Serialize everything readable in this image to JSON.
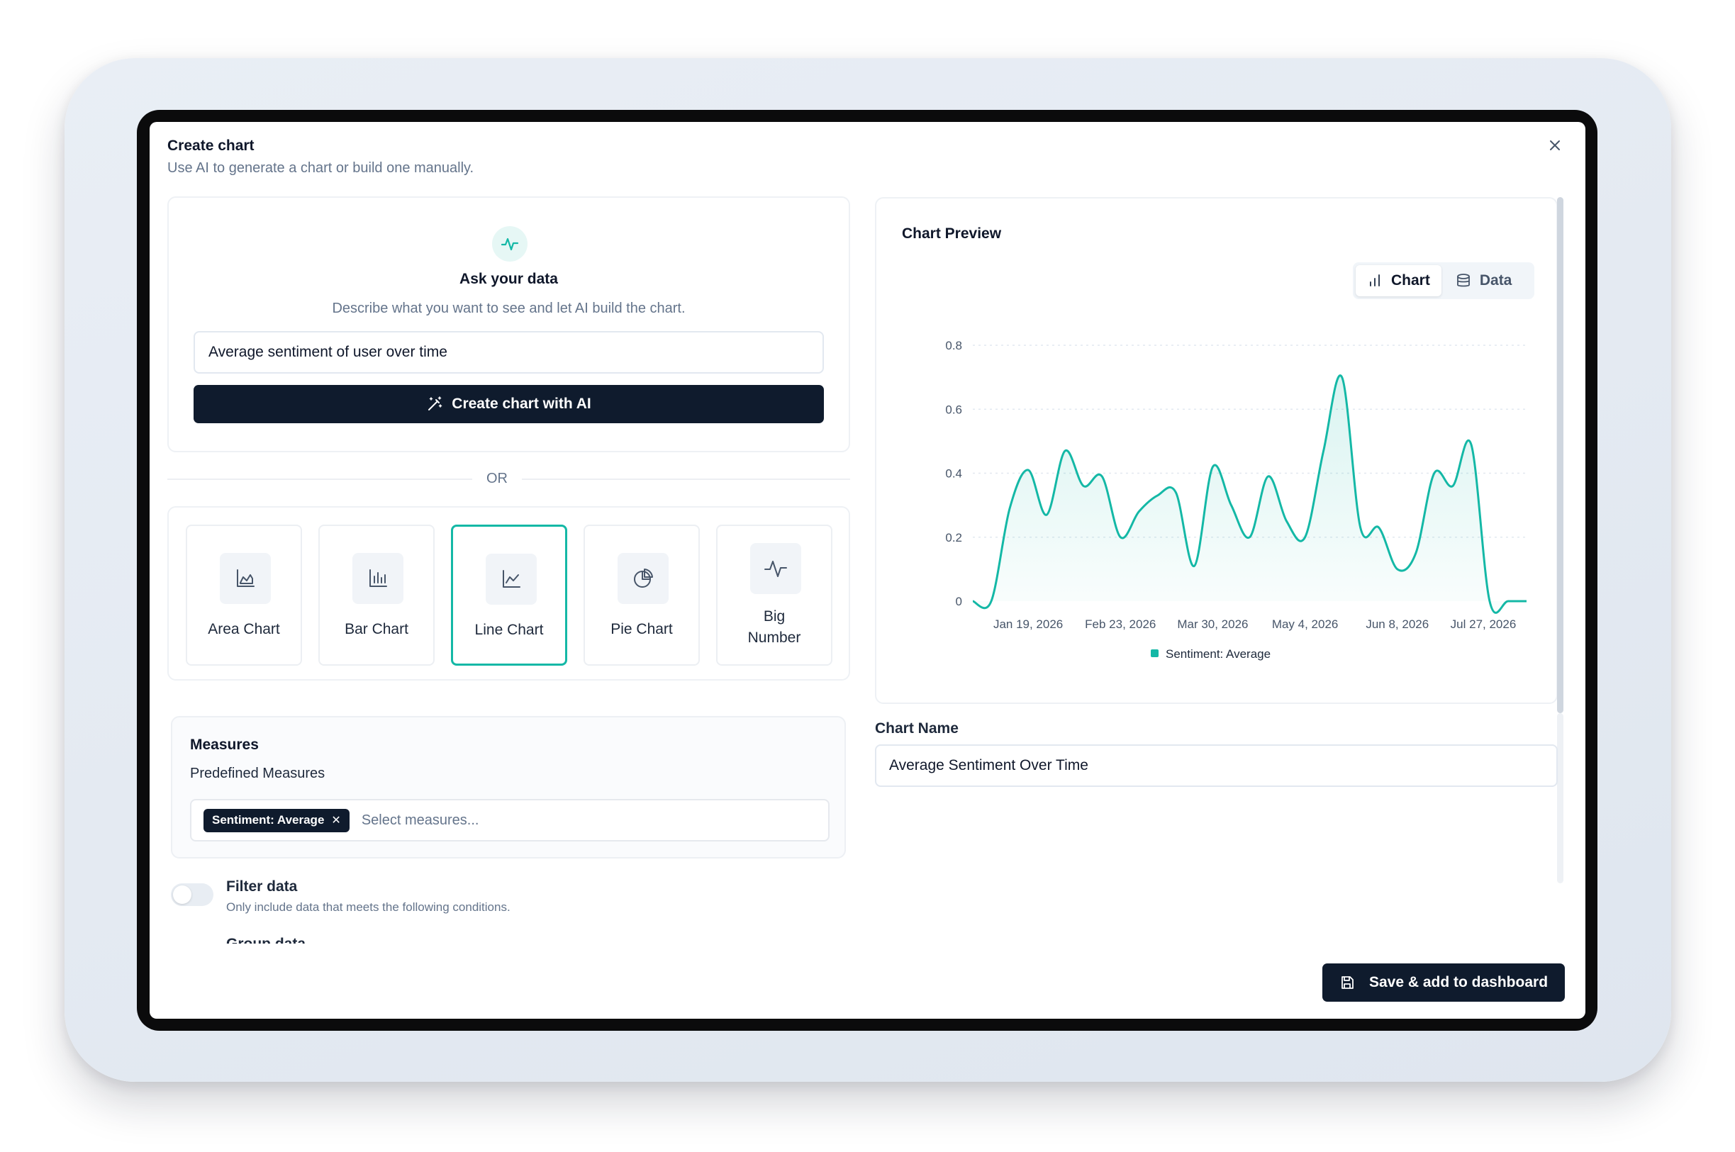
{
  "dialog": {
    "title": "Create chart",
    "subtitle": "Use AI to generate a chart or build one manually."
  },
  "ai": {
    "heading": "Ask your data",
    "description": "Describe what you want to see and let AI build the chart.",
    "prompt_value": "Average sentiment of user over time",
    "button_label": "Create chart with AI",
    "icon": "pulse-icon"
  },
  "divider": {
    "or_label": "OR"
  },
  "chart_types": [
    {
      "label": "Area Chart",
      "icon": "area-chart-icon",
      "selected": false
    },
    {
      "label": "Bar Chart",
      "icon": "bar-chart-icon",
      "selected": false
    },
    {
      "label": "Line Chart",
      "icon": "line-chart-icon",
      "selected": true
    },
    {
      "label": "Pie Chart",
      "icon": "pie-chart-icon",
      "selected": false
    },
    {
      "label": "Big Number",
      "icon": "pulse-icon",
      "selected": false
    }
  ],
  "measures": {
    "title": "Measures",
    "subtitle": "Predefined Measures",
    "chip_label": "Sentiment: Average",
    "placeholder": "Select measures..."
  },
  "filter": {
    "title": "Filter data",
    "description": "Only include data that meets the following conditions.",
    "enabled": false
  },
  "group": {
    "title": "Group data"
  },
  "preview": {
    "title": "Chart Preview",
    "tab_chart": "Chart",
    "tab_data": "Data",
    "active_tab": "Chart"
  },
  "chart_name": {
    "label": "Chart Name",
    "value": "Average Sentiment Over Time"
  },
  "save_button": {
    "label": "Save & add to dashboard"
  },
  "colors": {
    "accent": "#14b8a6",
    "primary_button": "#0f1b2d"
  },
  "chart_data": {
    "type": "area",
    "x_tick_labels": [
      "Jan 19, 2026",
      "Feb 23, 2026",
      "Mar 30, 2026",
      "May 4, 2026",
      "Jun 8, 2026",
      "Jul 27, 2026"
    ],
    "y_tick_labels": [
      "0",
      "0.2",
      "0.4",
      "0.6",
      "0.8"
    ],
    "ylim": [
      0,
      0.8
    ],
    "grid": "horizontal-dashed",
    "legend_position": "bottom",
    "series": [
      {
        "name": "Sentiment: Average",
        "color": "#14b8a6",
        "x": [
          "2025-12-29",
          "2026-01-05",
          "2026-01-12",
          "2026-01-19",
          "2026-01-26",
          "2026-02-02",
          "2026-02-09",
          "2026-02-16",
          "2026-02-23",
          "2026-03-02",
          "2026-03-09",
          "2026-03-16",
          "2026-03-23",
          "2026-03-30",
          "2026-04-06",
          "2026-04-13",
          "2026-04-20",
          "2026-04-27",
          "2026-05-04",
          "2026-05-11",
          "2026-05-18",
          "2026-05-25",
          "2026-06-01",
          "2026-06-08",
          "2026-06-15",
          "2026-06-22",
          "2026-06-29",
          "2026-07-06",
          "2026-07-13",
          "2026-07-20",
          "2026-07-27"
        ],
        "values": [
          0,
          0,
          0.29,
          0.41,
          0.27,
          0.47,
          0.36,
          0.39,
          0.2,
          0.28,
          0.33,
          0.34,
          0.11,
          0.42,
          0.3,
          0.2,
          0.39,
          0.25,
          0.2,
          0.47,
          0.7,
          0.23,
          0.23,
          0.1,
          0.15,
          0.4,
          0.36,
          0.49,
          0,
          0,
          0
        ]
      }
    ]
  }
}
